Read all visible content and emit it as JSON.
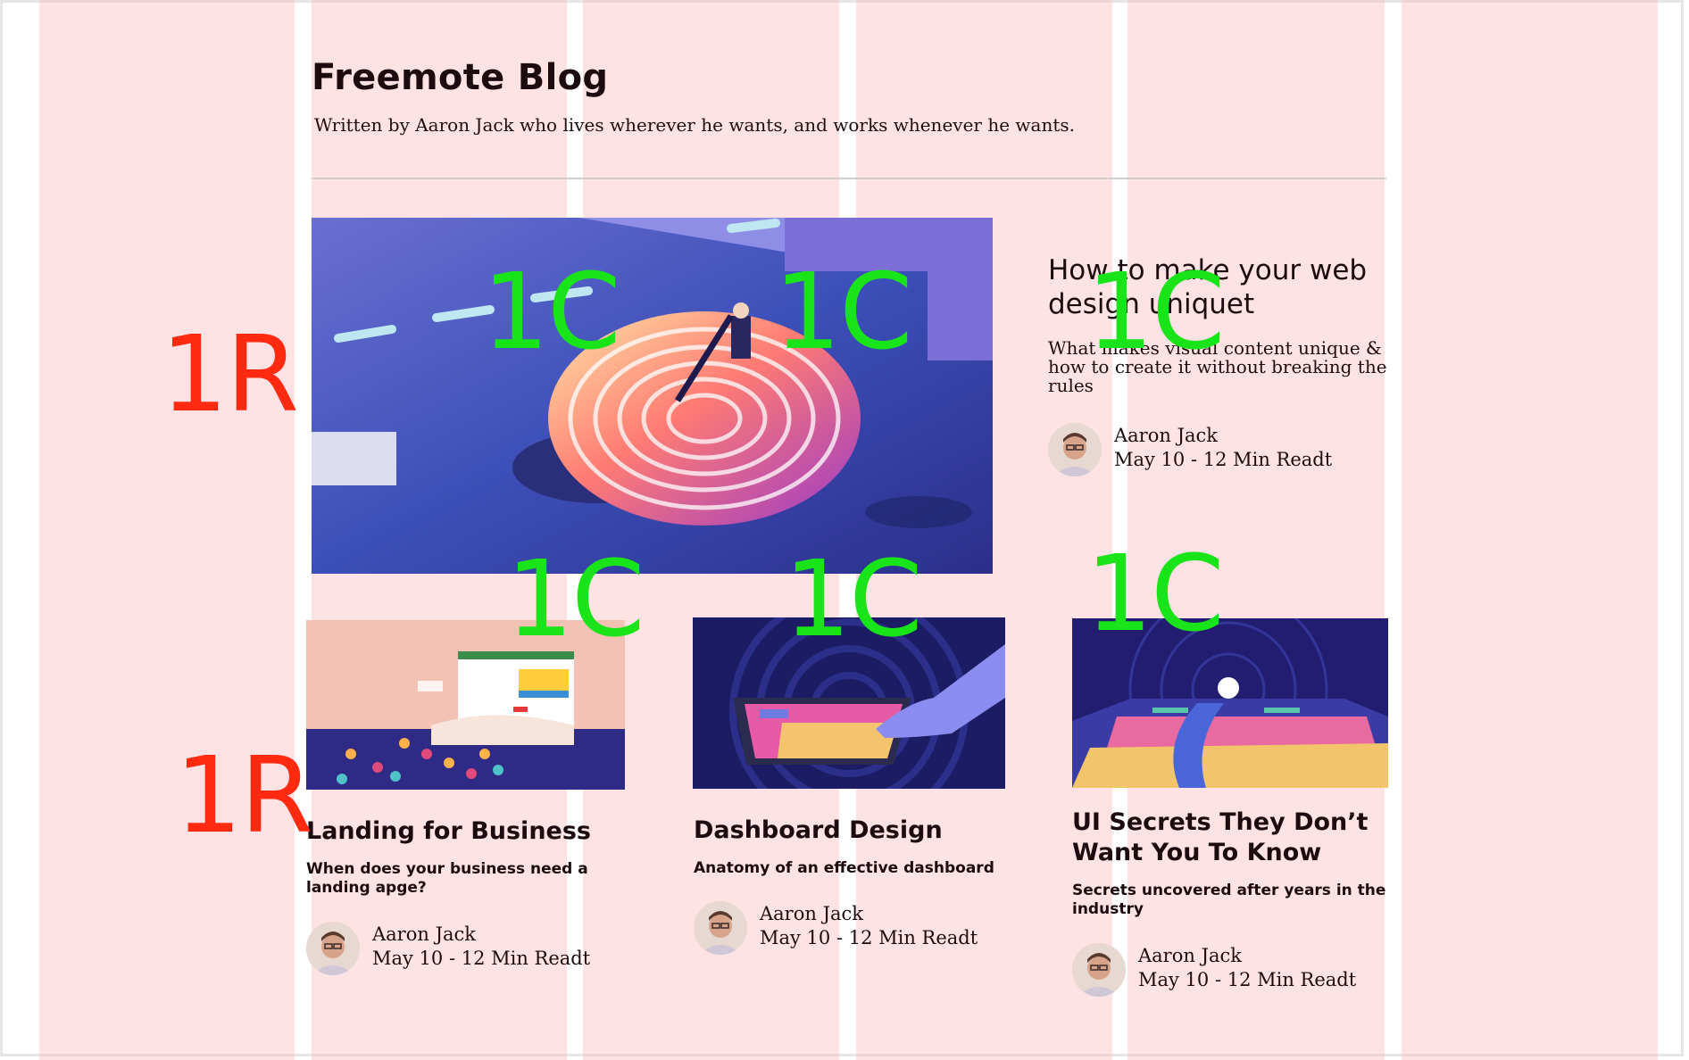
{
  "blog": {
    "title": "Freemote Blog",
    "subtitle": "Written by Aaron Jack who lives wherever he wants, and works whenever he wants."
  },
  "featured": {
    "image_icon": "fingerprint-pool-illustration",
    "title": "How to make your web design uniquet",
    "description": "What makes visual content unique & how to create it without breaking the rules",
    "author": "Aaron Jack",
    "meta": "May 10 - 12 Min Readt"
  },
  "cards": [
    {
      "image_icon": "landing-page-crowd-illustration",
      "title": "Landing for Business",
      "description": "When does your business need a landing apge?",
      "author": "Aaron Jack",
      "meta": "May 10 - 12 Min Readt"
    },
    {
      "image_icon": "tablet-hand-illustration",
      "title": "Dashboard Design",
      "description": "Anatomy of an effective dashboard",
      "author": "Aaron Jack",
      "meta": "May 10 - 12 Min Readt"
    },
    {
      "image_icon": "space-dashboard-illustration",
      "title": "UI Secrets They Don’t Want You To Know",
      "description": "Secrets uncovered after years in the industry",
      "author": "Aaron Jack",
      "meta": "May 10 - 12 Min Readt"
    }
  ],
  "grid_labels": {
    "row": "1R",
    "column": "1C"
  },
  "colors": {
    "overlay": "#ffb6ba",
    "row_label": "#ff2a10",
    "column_label": "#19e319",
    "text": "#1d0c0f"
  }
}
